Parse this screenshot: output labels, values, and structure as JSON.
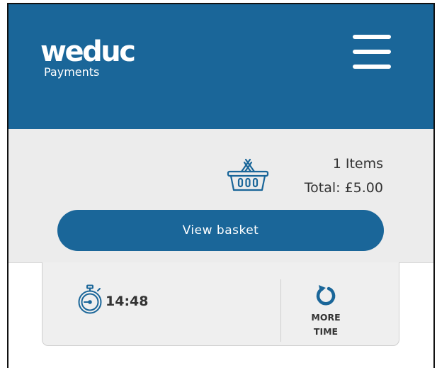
{
  "brand": {
    "name": "weduc",
    "subtitle": "Payments",
    "primary_color": "#1a6699"
  },
  "header": {
    "menu_icon": "hamburger-menu-icon"
  },
  "basket": {
    "icon": "shopping-basket-icon",
    "items_label": "1 Items",
    "total_label": "Total: £5.00",
    "view_button_label": "View basket"
  },
  "timer": {
    "icon": "stopwatch-icon",
    "time_remaining": "14:48",
    "more_time_icon": "refresh-icon",
    "more_time_label": "MORE\nTIME"
  }
}
